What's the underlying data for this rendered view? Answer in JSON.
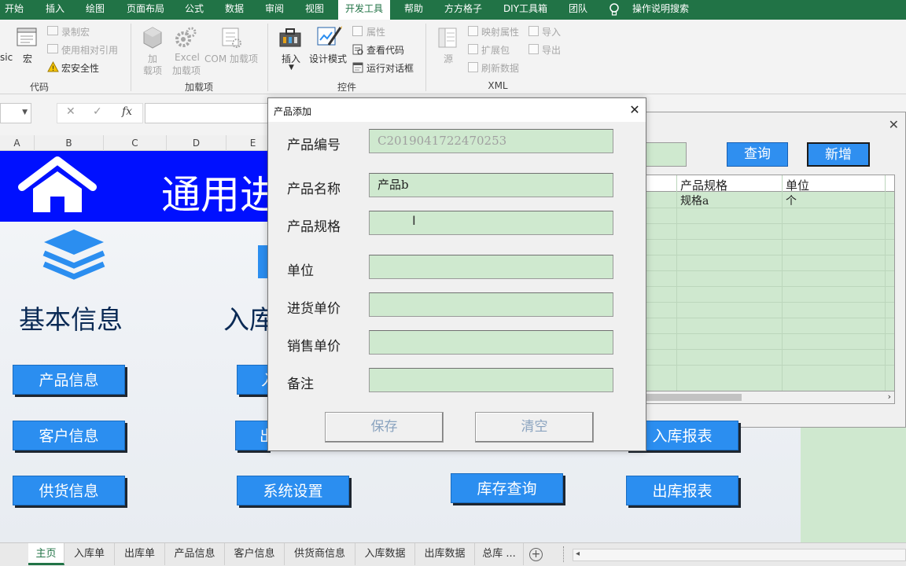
{
  "ribbon": {
    "tabs": [
      "开始",
      "插入",
      "绘图",
      "页面布局",
      "公式",
      "数据",
      "审阅",
      "视图",
      "开发工具",
      "帮助",
      "方方格子",
      "DIY工具箱",
      "团队",
      "操作说明搜索"
    ],
    "active_tab": "开发工具",
    "code_group": {
      "sic": "sic",
      "macro": "宏",
      "record_macro": "录制宏",
      "relative_ref": "使用相对引用",
      "macro_security": "宏安全性",
      "label": "代码"
    },
    "addins_group": {
      "addins_top": "加",
      "addins_bottom": "载项",
      "excel_top": "Excel",
      "excel_bottom": "加载项",
      "com": "COM 加载项",
      "label": "加载项"
    },
    "controls_group": {
      "insert": "插入",
      "design_mode": "设计模式",
      "properties": "属性",
      "view_code": "查看代码",
      "run_dialog": "运行对话框",
      "label": "控件"
    },
    "xml_group": {
      "source": "源",
      "map_props": "映射属性",
      "expansion": "扩展包",
      "refresh": "刷新数据",
      "import": "导入",
      "export": "导出",
      "label": "XML"
    }
  },
  "formula_bar": {
    "cancel": "✕",
    "enter": "✓",
    "fx": "fx"
  },
  "columns": [
    "A",
    "B",
    "C",
    "D",
    "E"
  ],
  "sheet": {
    "banner_title": "通用进销存",
    "basic_info": "基本信息",
    "inbound": "入库",
    "buttons": {
      "product_info": "产品信息",
      "customer_info": "客户信息",
      "supplier_info": "供货信息",
      "inbound_partial": "入",
      "outbound_partial": "出",
      "system_settings": "系统设置",
      "stock_query": "库存查询",
      "inbound_report": "入库报表",
      "outbound_report": "出库报表"
    }
  },
  "bg_dialog": {
    "query": "查询",
    "add": "新增",
    "columns": [
      "产品规格",
      "单位"
    ],
    "row": {
      "spec": "规格a",
      "unit": "个"
    }
  },
  "dialog": {
    "title": "产品添加",
    "fields": [
      {
        "label": "产品编号",
        "value": "C2019041722470253"
      },
      {
        "label": "产品名称",
        "value": "产品b"
      },
      {
        "label": "产品规格",
        "value": ""
      },
      {
        "label": "单位",
        "value": ""
      },
      {
        "label": "进货单价",
        "value": ""
      },
      {
        "label": "销售单价",
        "value": ""
      },
      {
        "label": "备注",
        "value": ""
      }
    ],
    "save": "保存",
    "clear": "清空"
  },
  "sheet_tabs": [
    "主页",
    "入库单",
    "出库单",
    "产品信息",
    "客户信息",
    "供货商信息",
    "入库数据",
    "出库数据",
    "总库 ..."
  ],
  "active_sheet": "主页",
  "colors": {
    "ribbon_green": "#217346",
    "banner_blue": "#0010ff",
    "button_blue": "#2b8ef0",
    "input_green": "#cfe9cf"
  }
}
